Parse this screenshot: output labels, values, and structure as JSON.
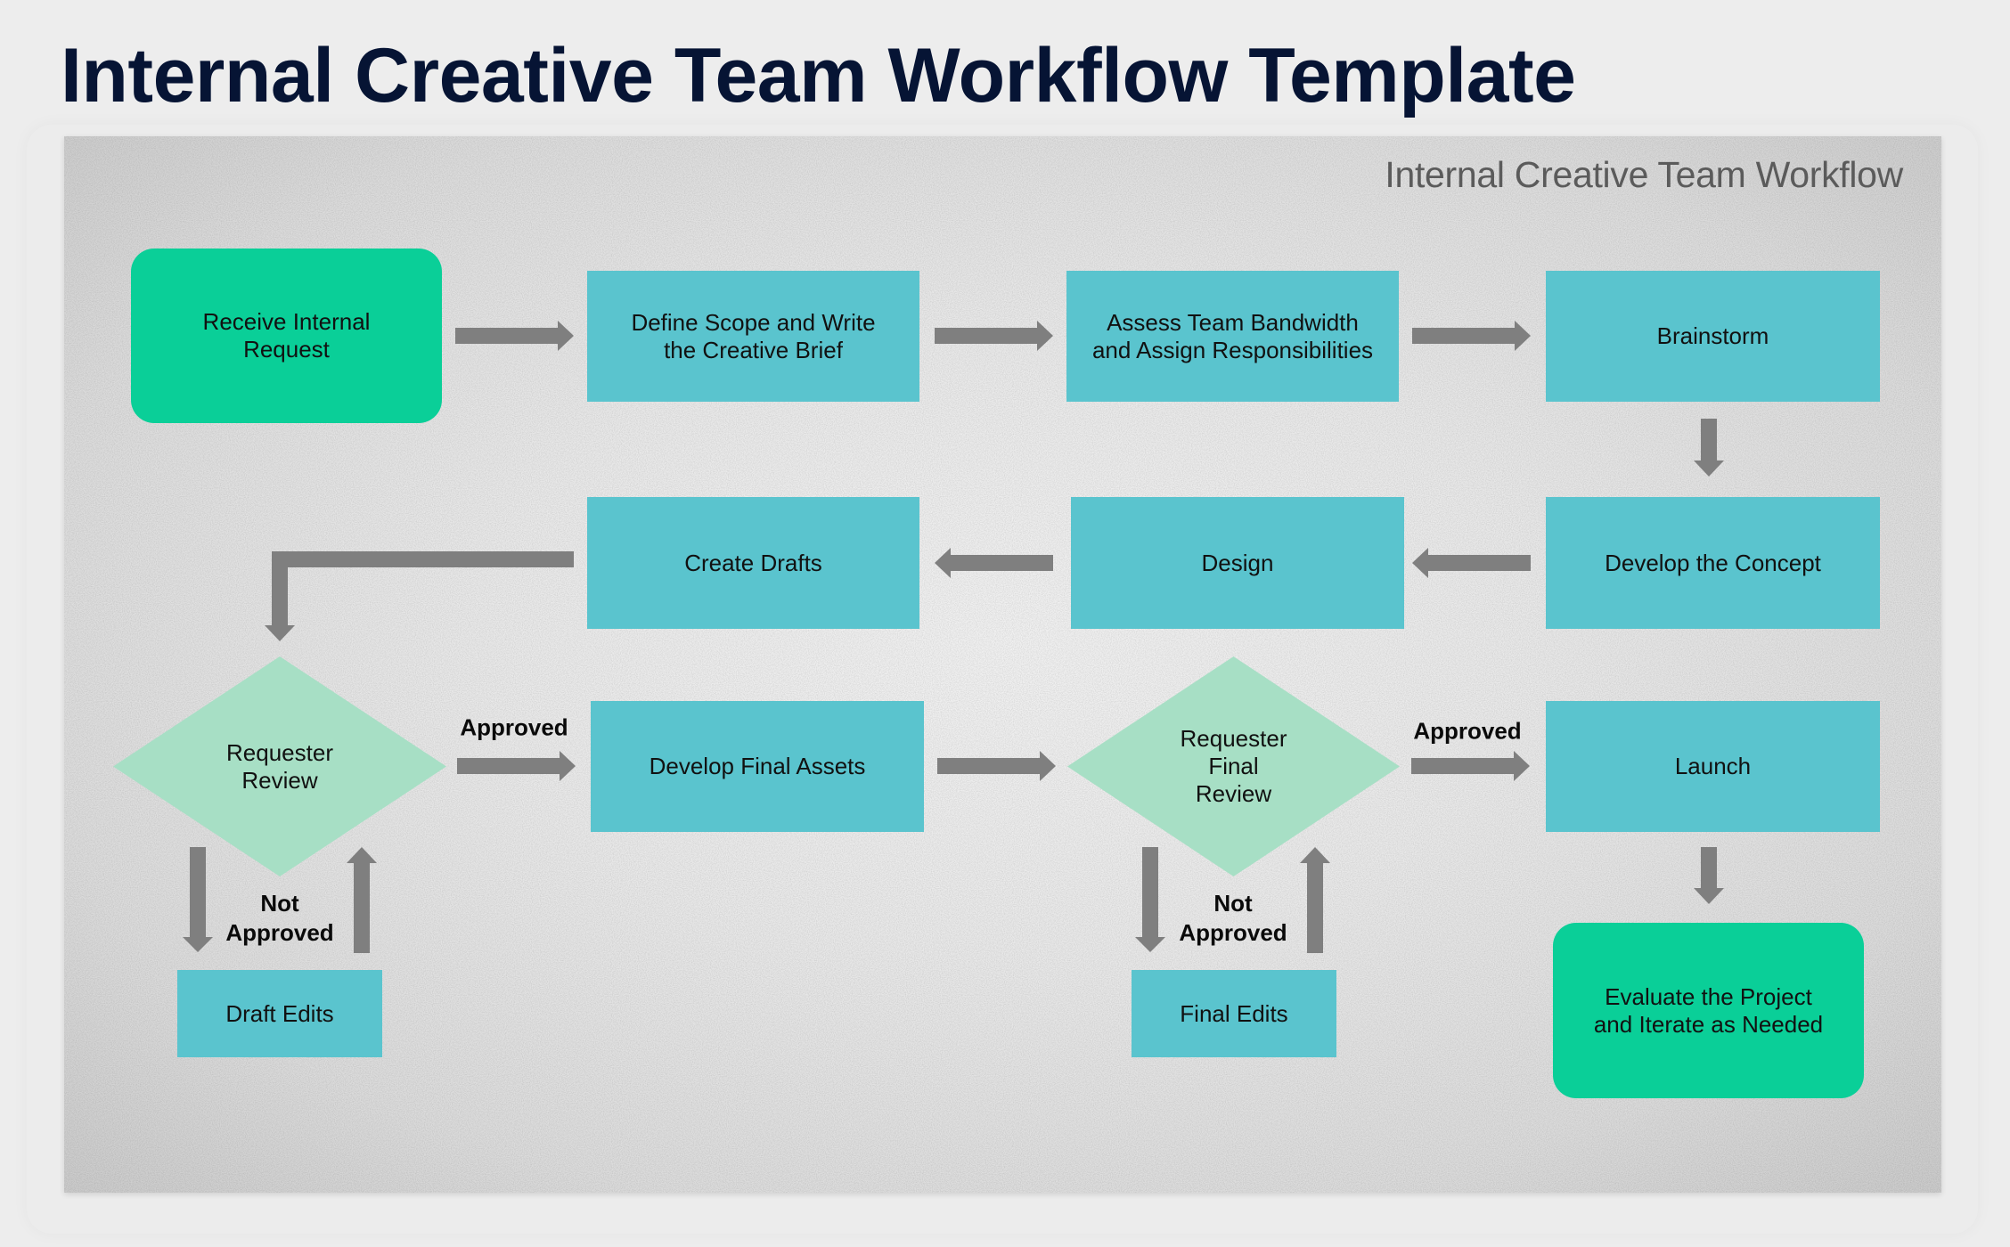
{
  "page": {
    "title": "Internal Creative Team Workflow Template"
  },
  "diagram": {
    "subtitle": "Internal Creative Team Workflow",
    "colors": {
      "process_box": "#5ac4ce",
      "terminal_box": "#0acf98",
      "decision": "#a7dfc5",
      "arrow": "#7f7f7f",
      "title": "#061434",
      "subtitle": "#5b5b5b"
    },
    "nodes": {
      "receive_request": {
        "type": "terminal",
        "lines": [
          "Receive Internal",
          "Request"
        ]
      },
      "define_scope": {
        "type": "process",
        "lines": [
          "Define Scope and Write",
          "the Creative Brief"
        ]
      },
      "assess_bandwidth": {
        "type": "process",
        "lines": [
          "Assess Team Bandwidth",
          "and Assign Responsibilities"
        ]
      },
      "brainstorm": {
        "type": "process",
        "lines": [
          "Brainstorm"
        ]
      },
      "develop_concept": {
        "type": "process",
        "lines": [
          "Develop the Concept"
        ]
      },
      "design": {
        "type": "process",
        "lines": [
          "Design"
        ]
      },
      "create_drafts": {
        "type": "process",
        "lines": [
          "Create Drafts"
        ]
      },
      "requester_review": {
        "type": "decision",
        "lines": [
          "Requester",
          "Review"
        ]
      },
      "develop_final_assets": {
        "type": "process",
        "lines": [
          "Develop Final Assets"
        ]
      },
      "requester_final_review": {
        "type": "decision",
        "lines": [
          "Requester",
          "Final",
          "Review"
        ]
      },
      "launch": {
        "type": "process",
        "lines": [
          "Launch"
        ]
      },
      "evaluate_project": {
        "type": "terminal",
        "lines": [
          "Evaluate the Project",
          "and Iterate as Needed"
        ]
      },
      "draft_edits": {
        "type": "process",
        "lines": [
          "Draft Edits"
        ]
      },
      "final_edits": {
        "type": "process",
        "lines": [
          "Final Edits"
        ]
      }
    },
    "edge_labels": {
      "approved_1": [
        "Approved"
      ],
      "approved_2": [
        "Approved"
      ],
      "not_approved_1": [
        "Not",
        "Approved"
      ],
      "not_approved_2": [
        "Not",
        "Approved"
      ]
    },
    "edges": [
      {
        "from": "receive_request",
        "to": "define_scope"
      },
      {
        "from": "define_scope",
        "to": "assess_bandwidth"
      },
      {
        "from": "assess_bandwidth",
        "to": "brainstorm"
      },
      {
        "from": "brainstorm",
        "to": "develop_concept"
      },
      {
        "from": "develop_concept",
        "to": "design"
      },
      {
        "from": "design",
        "to": "create_drafts"
      },
      {
        "from": "create_drafts",
        "to": "requester_review"
      },
      {
        "from": "requester_review",
        "to": "develop_final_assets",
        "label": "Approved"
      },
      {
        "from": "requester_review",
        "to": "draft_edits",
        "label": "Not Approved"
      },
      {
        "from": "draft_edits",
        "to": "requester_review"
      },
      {
        "from": "develop_final_assets",
        "to": "requester_final_review"
      },
      {
        "from": "requester_final_review",
        "to": "launch",
        "label": "Approved"
      },
      {
        "from": "requester_final_review",
        "to": "final_edits",
        "label": "Not Approved"
      },
      {
        "from": "final_edits",
        "to": "requester_final_review"
      },
      {
        "from": "launch",
        "to": "evaluate_project"
      }
    ]
  }
}
